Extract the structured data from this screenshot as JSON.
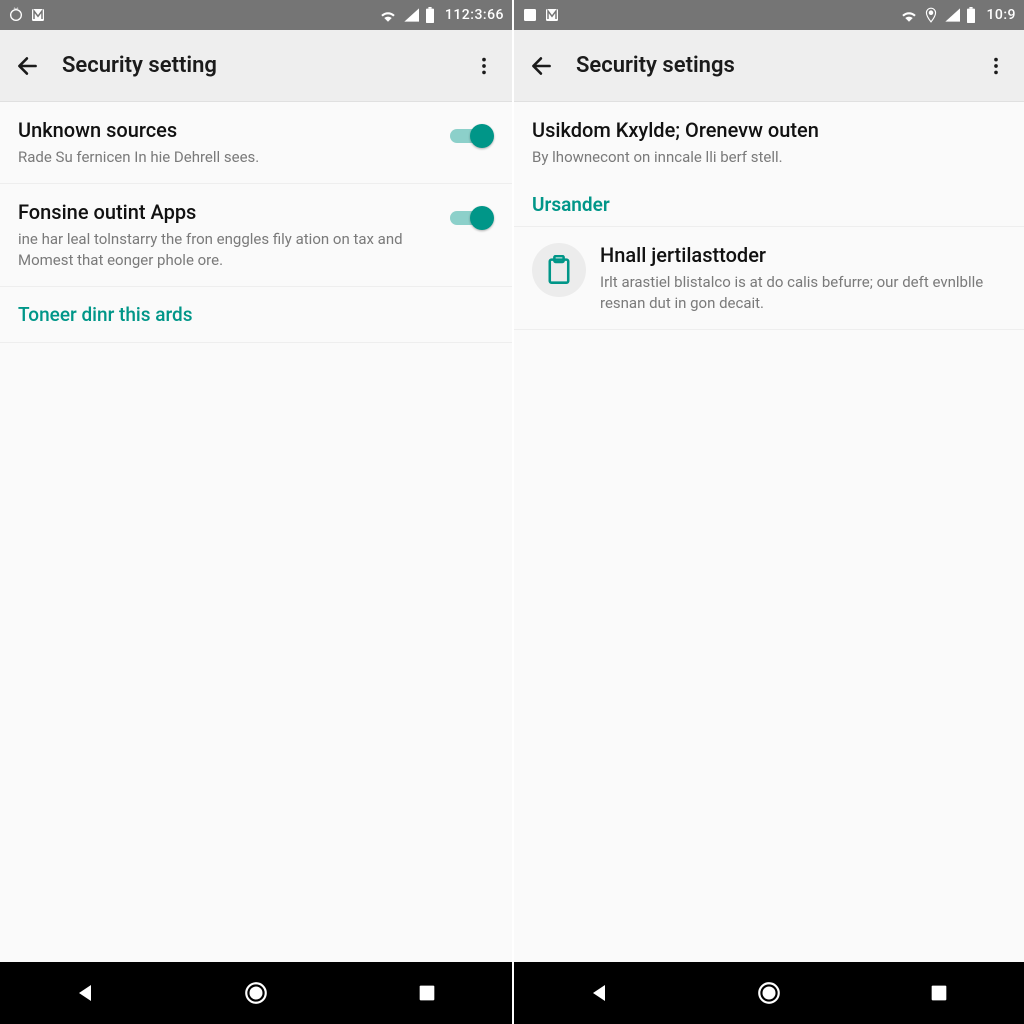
{
  "colors": {
    "accent": "#009688",
    "accentLight": "#80cbc4",
    "statusbar": "#757575"
  },
  "left": {
    "status": {
      "time": "112:3:66",
      "icons_left": [
        "loop-icon",
        "m-box-icon"
      ],
      "icons_right": [
        "wifi",
        "signal",
        "battery"
      ]
    },
    "appbar": {
      "title": "Security setting"
    },
    "rows": [
      {
        "title": "Unknown sources",
        "sub": "Rade Su fernicen In hie Dehrell sees.",
        "toggle": true
      },
      {
        "title": "Fonsine outint Apps",
        "sub": "ine har leal tolnstarry the fron enggles fily ation on tax and Momest that eonger phole ore.",
        "toggle": true
      }
    ],
    "section_link": "Toneer dinr this ards"
  },
  "right": {
    "status": {
      "time": "10:9",
      "icons_left": [
        "sim-box-icon",
        "m-box-icon"
      ],
      "icons_right": [
        "wifi",
        "location",
        "signal",
        "battery"
      ]
    },
    "appbar": {
      "title": "Security setings"
    },
    "header_row": {
      "title": "Usikdom Kxylde; Orenevw outen",
      "sub": "By lhownecont on inncale lli berf stell."
    },
    "section_header": "Ursander",
    "detail": {
      "title": "Hnall jertilasttoder",
      "sub": "Irlt arastiel blistalco is at do calis befurre; our deft evnlblle resnan dut in gon decait."
    }
  }
}
